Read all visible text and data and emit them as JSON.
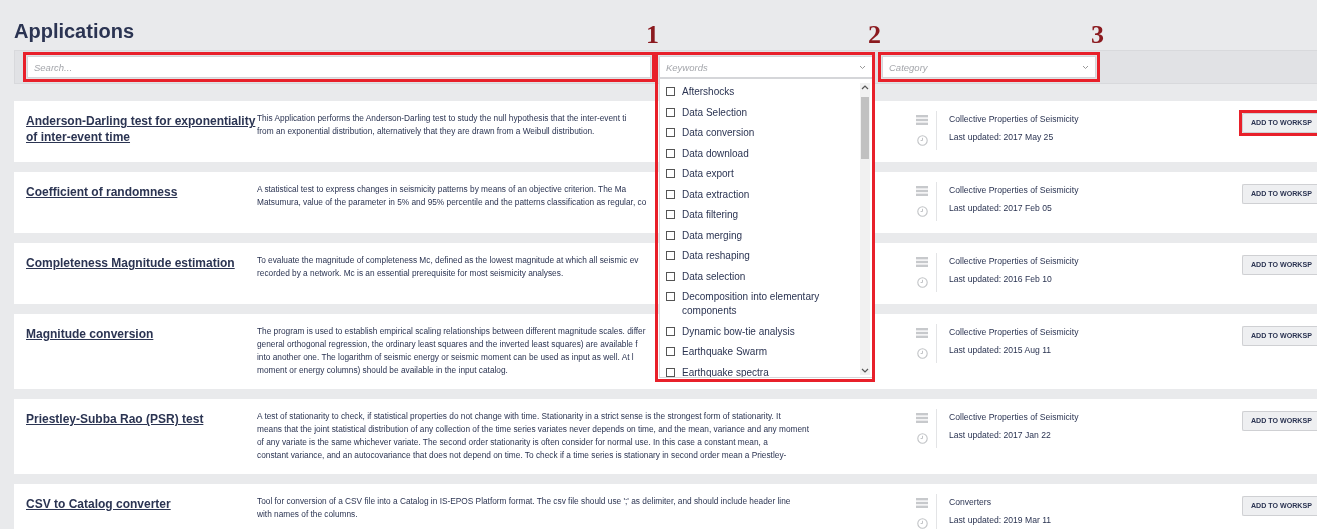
{
  "title": "Applications",
  "filters": {
    "search": {
      "placeholder": "Search...",
      "marker": "1",
      "highlighted": true
    },
    "keywords": {
      "placeholder": "Keywords",
      "marker": "2",
      "highlighted": true,
      "expanded": true,
      "options": [
        {
          "label": "Aftershocks",
          "checked": false
        },
        {
          "label": "Data Selection",
          "checked": false
        },
        {
          "label": "Data conversion",
          "checked": false
        },
        {
          "label": "Data download",
          "checked": false
        },
        {
          "label": "Data export",
          "checked": false
        },
        {
          "label": "Data extraction",
          "checked": false
        },
        {
          "label": "Data filtering",
          "checked": false
        },
        {
          "label": "Data merging",
          "checked": false
        },
        {
          "label": "Data reshaping",
          "checked": false
        },
        {
          "label": "Data selection",
          "checked": false
        },
        {
          "label": "Decomposition into elementary components",
          "checked": false
        },
        {
          "label": "Dynamic bow-tie analysis",
          "checked": false
        },
        {
          "label": "Earthquake Swarm",
          "checked": false
        },
        {
          "label": "Earthquake spectra",
          "checked": false
        }
      ]
    },
    "category": {
      "placeholder": "Category",
      "marker": "3",
      "highlighted": true
    }
  },
  "applications": [
    {
      "title": "Anderson-Darling test for exponentiality of inter-event time",
      "description": [
        "This Application performs the Anderson-Darling test to study the null hypothesis that the inter-event ti",
        "from an exponential distribution, alternatively that they are drawn from a Weibull distribution."
      ],
      "category": "Collective Properties of Seismicity",
      "updated": "Last updated: 2017 May 25",
      "button": "ADD TO WORKSP",
      "highlighted": true
    },
    {
      "title": "Coefficient of randomness",
      "description": [
        "A statistical test to express changes in seismicity patterns by means of an objective criterion. The Ma",
        "Matsumura, value of the parameter in 5% and 95% percentile and the patterns classification as regular, co"
      ],
      "category": "Collective Properties of Seismicity",
      "updated": "Last updated: 2017 Feb 05",
      "button": "ADD TO WORKSP",
      "highlighted": false
    },
    {
      "title": "Completeness Magnitude estimation",
      "description": [
        "To evaluate the magnitude of completeness Mc, defined as the lowest magnitude at which all seismic ev",
        "recorded by a network. Mc is an essential prerequisite for most seismicity analyses."
      ],
      "category": "Collective Properties of Seismicity",
      "updated": "Last updated: 2016 Feb 10",
      "button": "ADD TO WORKSP",
      "highlighted": false
    },
    {
      "title": "Magnitude conversion",
      "description": [
        "The program is used to establish empirical scaling relationships between different magnitude scales. differ",
        "general orthogonal regression, the ordinary least squares and the inverted least squares) are available f",
        "into another one. The logarithm of seismic energy or seismic moment can be used as input as well. At l",
        "moment or energy columns) should be available in the input catalog."
      ],
      "category": "Collective Properties of Seismicity",
      "updated": "Last updated: 2015 Aug 11",
      "button": "ADD TO WORKSP",
      "highlighted": false
    },
    {
      "title": "Priestley-Subba Rao (PSR) test",
      "description": [
        "A test of stationarity to check, if statistical properties do not change with time. Stationarity in a strict sense is the strongest form of stationarity. It",
        "means that the joint statistical distribution of any collection of the time series variates never depends on time, and the mean, variance and any moment",
        "of any variate is the same whichever variate. The second order stationarity is often consider for normal use. In this case a constant mean, a",
        "constant variance, and an autocovariance that does not depend on time. To check if a time series is stationary in second order mean a Priestley-"
      ],
      "category": "Collective Properties of Seismicity",
      "updated": "Last updated: 2017 Jan 22",
      "button": "ADD TO WORKSP",
      "highlighted": false
    },
    {
      "title": "CSV to Catalog converter",
      "description": [
        "Tool for conversion of a CSV file into a Catalog in IS-EPOS Platform format. The csv file should use ';' as delimiter, and should include header line",
        "with names of the columns."
      ],
      "category": "Converters",
      "updated": "Last updated: 2019 Mar 11",
      "button": "ADD TO WORKSP",
      "highlighted": false
    }
  ]
}
